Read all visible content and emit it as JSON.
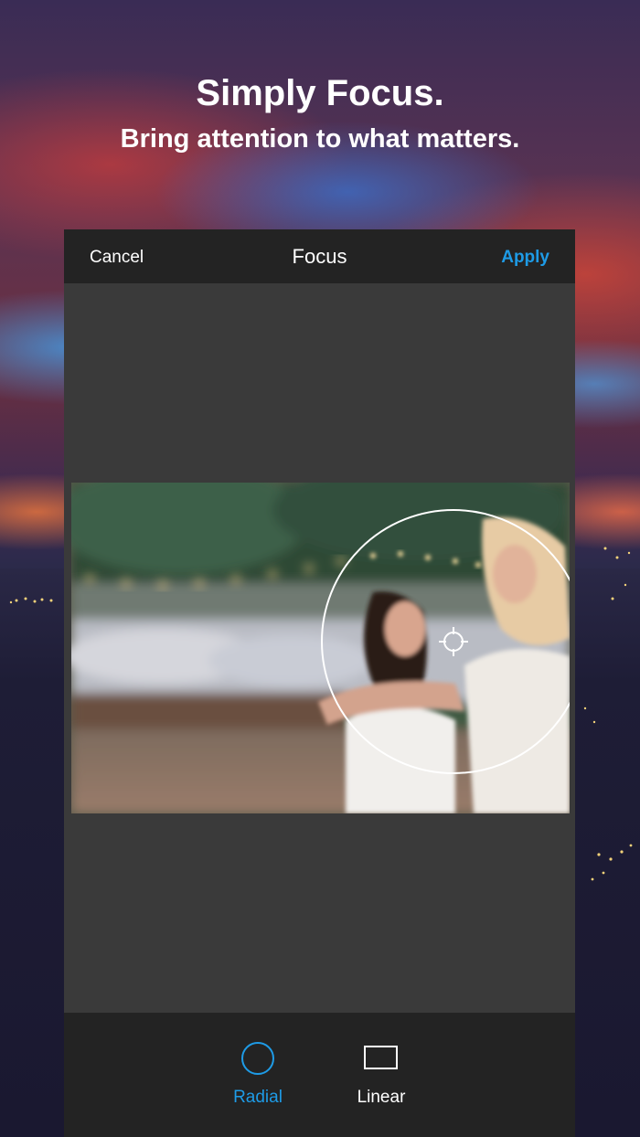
{
  "promo": {
    "title": "Simply Focus.",
    "subtitle": "Bring attention to what matters."
  },
  "navbar": {
    "cancel_label": "Cancel",
    "title": "Focus",
    "apply_label": "Apply"
  },
  "toolbar": {
    "tools": [
      {
        "label": "Radial",
        "icon": "circle-icon",
        "selected": true
      },
      {
        "label": "Linear",
        "icon": "rectangle-icon",
        "selected": false
      }
    ]
  },
  "colors": {
    "accent": "#1e9be6",
    "panel": "#3a3a3a",
    "bar": "#232323"
  }
}
